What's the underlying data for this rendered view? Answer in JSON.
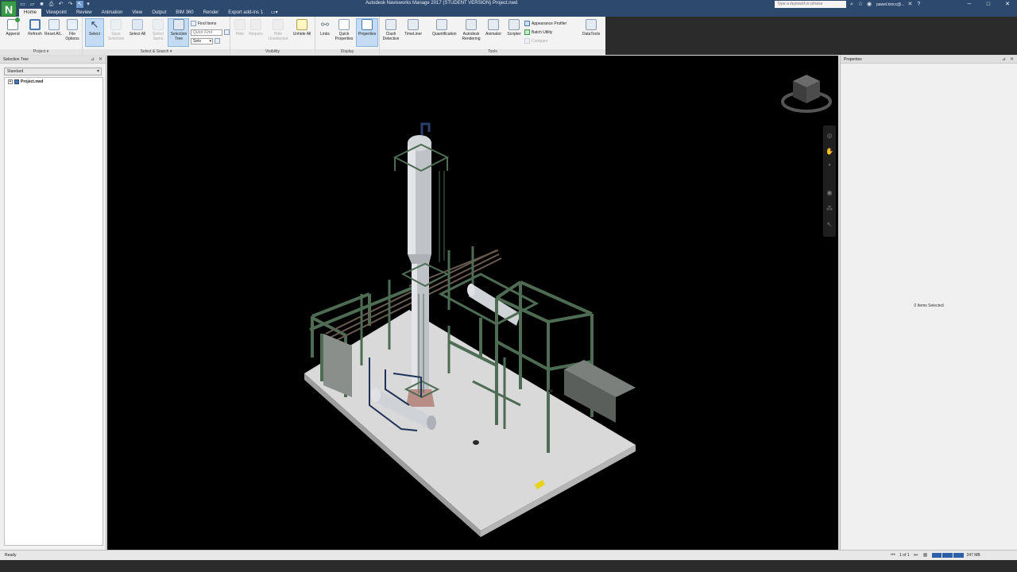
{
  "app": {
    "logo": "N",
    "window_title": "Autodesk Navisworks Manage 2017 (STUDENT VERSION)    Project.nwd",
    "search_placeholder": "Type a keyword or phrase",
    "user_name": "pawel.kmcc@..."
  },
  "ribbon_tabs": [
    "Home",
    "Viewpoint",
    "Review",
    "Animation",
    "View",
    "Output",
    "BIM 360",
    "Render",
    "Export add-ins 1"
  ],
  "ribbon": {
    "project": {
      "title": "Project ▾",
      "append": "Append",
      "refresh": "Refresh",
      "reset_all": "Reset All...",
      "file_options": "File Options"
    },
    "select_search": {
      "title": "Select & Search ▾",
      "select": "Select",
      "save_selection": "Save Selection",
      "select_all": "Select All",
      "select_same": "Select Same",
      "selection_tree": "Selection Tree",
      "find_items": "Find Items",
      "quick_find_placeholder": "Quick Find",
      "sets": "Sets"
    },
    "visibility": {
      "title": "Visibility",
      "hide": "Hide",
      "require": "Require",
      "hide_unselected": "Hide Unselected",
      "unhide_all": "Unhide All"
    },
    "display": {
      "title": "Display",
      "links": "Links",
      "quick_properties": "Quick Properties",
      "properties": "Properties"
    },
    "tools": {
      "title": "Tools",
      "clash_detective": "Clash Detective",
      "timeliner": "TimeLiner",
      "quantification": "Quantification",
      "autodesk_rendering": "Autodesk Rendering",
      "animator": "Animator",
      "scripter": "Scripter",
      "appearance_profiler": "Appearance Profiler",
      "batch_utility": "Batch Utility",
      "compare": "Compare",
      "datatools": "DataTools"
    }
  },
  "selection_tree": {
    "title": "Selection Tree",
    "mode": "Standard",
    "root_node": "Project.nwd"
  },
  "properties_panel": {
    "title": "Properties",
    "empty_text": "0 Items Selected"
  },
  "status": {
    "text": "Ready",
    "page": "1 of 1",
    "memory": "247 MB"
  },
  "colors": {
    "titlebar": "#2d4a6e",
    "steel": "#3f5a45",
    "platform": "#d8d8d8",
    "vessel": "#c9ccd0"
  }
}
